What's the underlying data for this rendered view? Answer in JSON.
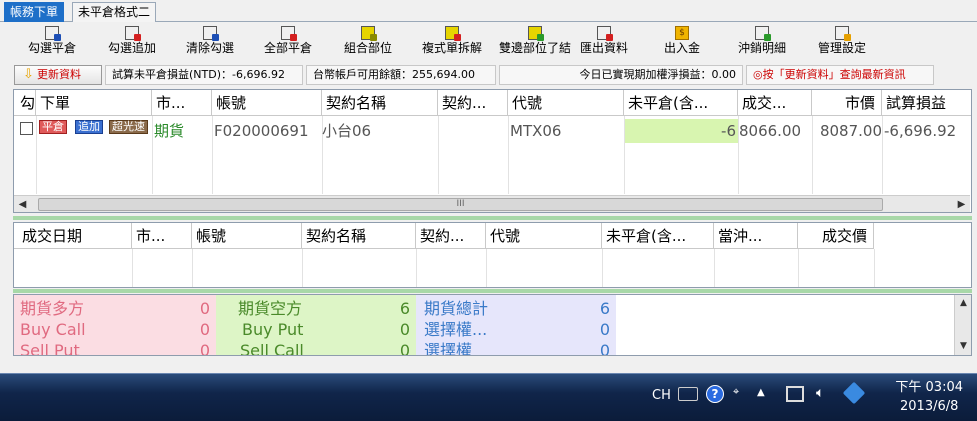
{
  "tabs": [
    {
      "label": "帳務下單"
    },
    {
      "label": "未平倉格式二"
    }
  ],
  "toolbar": {
    "buttons": [
      {
        "label": "勾選平倉",
        "icon": "checklist-close-icon"
      },
      {
        "label": "勾選追加",
        "icon": "checklist-add-icon"
      },
      {
        "label": "清除勾選",
        "icon": "clear-check-icon"
      },
      {
        "label": "全部平倉",
        "icon": "close-all-icon"
      },
      {
        "label": "組合部位",
        "icon": "combo-position-icon"
      },
      {
        "label": "複式單拆解",
        "icon": "split-order-icon"
      },
      {
        "label": "雙邊部位了結",
        "icon": "settle-both-icon"
      },
      {
        "label": "匯出資料",
        "icon": "export-icon"
      },
      {
        "label": "出入金",
        "icon": "money-icon"
      },
      {
        "label": "沖銷明細",
        "icon": "offset-detail-icon"
      },
      {
        "label": "管理設定",
        "icon": "settings-icon"
      }
    ]
  },
  "infobar": {
    "refresh_label": "更新資料",
    "trial_pnl": "試算未平倉損益(NTD)：-6,696.92",
    "available_balance": "台幣帳戶可用餘額：255,694.00",
    "realized_today": "今日已實現期加權淨損益：0.00",
    "hint": "◎按「更新資料」查詢最新資訊"
  },
  "grid1": {
    "headers": [
      "勾",
      "下單",
      "市...",
      "帳號",
      "契約名稱",
      "契約...",
      "代號",
      "未平倉(含...",
      "成交...",
      "市價",
      "試算損益"
    ],
    "row": {
      "btn_close": "平倉",
      "btn_add": "追加",
      "btn_fast": "超光速",
      "market": "期貨",
      "account": "F020000691",
      "contract_name": "小台06",
      "contract_month": "",
      "symbol": "MTX06",
      "open_qty": "-6",
      "trade_price": "8066.00",
      "market_price": "8087.00",
      "trial_pnl": "-6,696.92"
    },
    "scroll_grip": "III"
  },
  "grid2": {
    "headers": [
      "成交日期",
      "市...",
      "帳號",
      "契約名稱",
      "契約...",
      "代號",
      "未平倉(含...",
      "當沖...",
      "成交價"
    ]
  },
  "summary": {
    "col1": [
      {
        "label": "期貨多方",
        "value": "0"
      },
      {
        "label": "Buy Call",
        "value": "0"
      },
      {
        "label": "Sell Put",
        "value": "0"
      }
    ],
    "col2": [
      {
        "label": "期貨空方",
        "value": "6"
      },
      {
        "label": "Buy Put",
        "value": "0"
      },
      {
        "label": "Sell Call",
        "value": "0"
      }
    ],
    "col3": [
      {
        "label": "期貨總計",
        "value": "6"
      },
      {
        "label": "選擇權...",
        "value": "0"
      },
      {
        "label": "選擇權",
        "value": "0"
      }
    ]
  },
  "taskbar": {
    "lang": "CH",
    "time": "下午 03:04",
    "date": "2013/6/8"
  },
  "colors": {
    "tab_active": "#1e6fc8",
    "qty_highlight": "#d8f5b0",
    "buy_bg": "#fbdde3",
    "sell_bg": "#ddf5c6",
    "total_bg": "#e6e6fb"
  }
}
